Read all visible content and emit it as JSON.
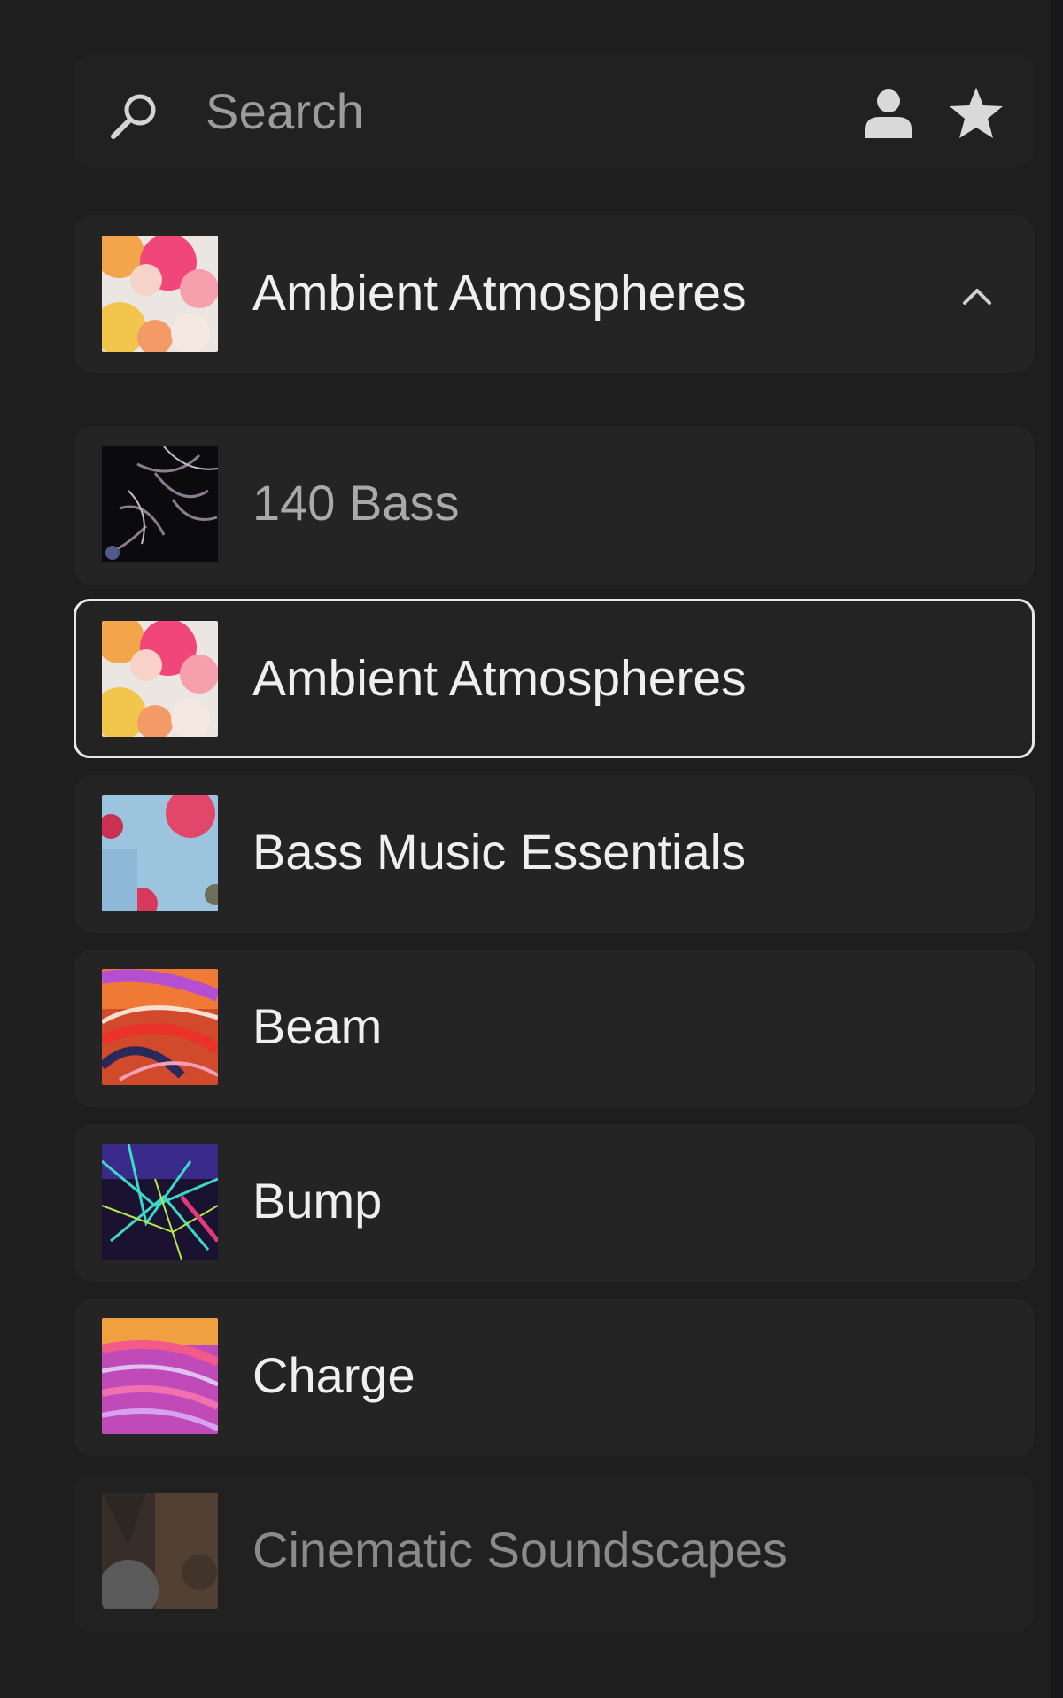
{
  "search": {
    "placeholder": "Search"
  },
  "toolbar": {
    "user_icon": "user-icon",
    "star_icon": "star-icon"
  },
  "current_pack": {
    "name": "Ambient Atmospheres",
    "expanded": true
  },
  "packs": [
    {
      "name": "140 Bass",
      "state": "dim"
    },
    {
      "name": "Ambient Atmospheres",
      "state": "selected"
    },
    {
      "name": "Bass Music Essentials",
      "state": "normal"
    },
    {
      "name": "Beam",
      "state": "normal"
    },
    {
      "name": "Bump",
      "state": "normal"
    },
    {
      "name": "Charge",
      "state": "normal"
    },
    {
      "name": "Cinematic Soundscapes",
      "state": "faded"
    }
  ],
  "colors": {
    "background": "#1e1e1f",
    "card": "#242425",
    "selected_border": "#e7e7e7",
    "text": "#efefef",
    "muted_text": "#9b9b9c"
  }
}
